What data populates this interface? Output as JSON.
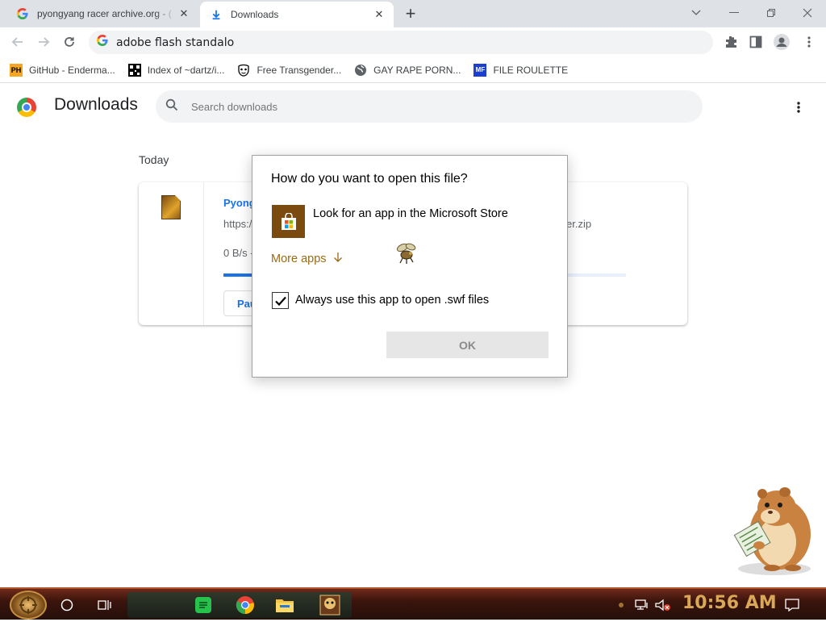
{
  "tabs": [
    {
      "title": "pyongyang racer archive.org - (",
      "icon": "google-g-icon"
    },
    {
      "title": "Downloads",
      "icon": "download-icon"
    }
  ],
  "omnibox": {
    "value": "adobe flash standalo"
  },
  "bookmarks": [
    {
      "label": "GitHub - Enderma...",
      "icon_text": "PH",
      "icon": "ph-icon"
    },
    {
      "label": "Index of ~dartz/i...",
      "icon": "qr-icon"
    },
    {
      "label": "Free Transgender...",
      "icon": "mask-icon"
    },
    {
      "label": "GAY RAPE PORN...",
      "icon": "globe-icon"
    },
    {
      "label": "FILE ROULETTE",
      "icon_text": "MF",
      "icon": "mf-icon"
    }
  ],
  "downloads_page": {
    "title": "Downloads",
    "search_placeholder": "Search downloads",
    "section": "Today",
    "item": {
      "name": "Pyong",
      "url": "https:/",
      "url_end": "er.zip",
      "status": "0 B/s -",
      "progress_fraction": 0.76,
      "pause_label": "Pau"
    }
  },
  "dialog": {
    "title": "How do you want to open this file?",
    "store_option": "Look for an app in the Microsoft Store",
    "more_apps": "More apps",
    "checkbox_label": "Always use this app to open .swf files",
    "checkbox_checked": true,
    "ok_label": "OK"
  },
  "taskbar": {
    "clock": "10:56 AM"
  },
  "colors": {
    "accent": "#1a73e8",
    "more_apps": "#9a6a14",
    "store_tile": "#7b4a0e",
    "clock": "#d9a756"
  }
}
